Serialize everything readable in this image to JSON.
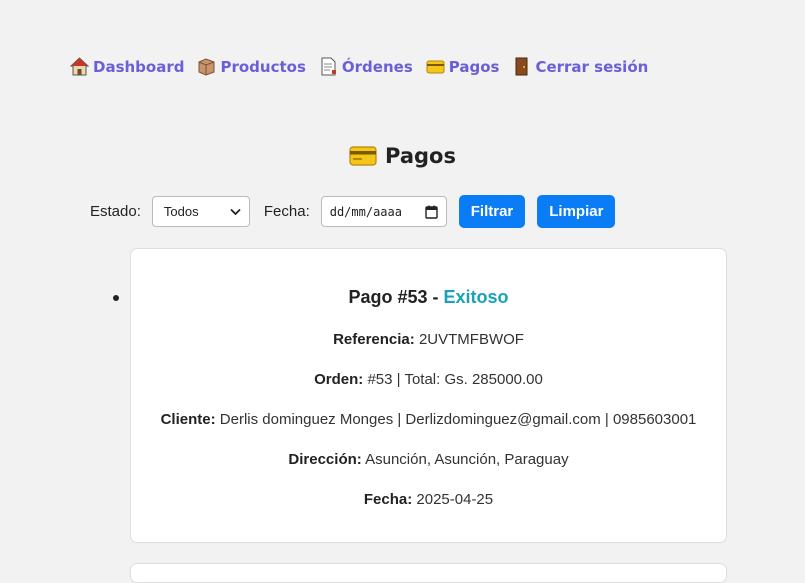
{
  "nav": {
    "items": [
      {
        "label": "Dashboard",
        "icon": "house-icon"
      },
      {
        "label": "Productos",
        "icon": "box-icon"
      },
      {
        "label": "Órdenes",
        "icon": "document-icon"
      },
      {
        "label": "Pagos",
        "icon": "credit-card-icon"
      },
      {
        "label": "Cerrar sesión",
        "icon": "door-icon"
      }
    ]
  },
  "page": {
    "title": "Pagos",
    "title_icon": "credit-card-icon"
  },
  "filters": {
    "estado_label": "Estado:",
    "estado_value": "Todos",
    "fecha_label": "Fecha:",
    "fecha_placeholder": "dd/mm/aaaa",
    "filter_button": "Filtrar",
    "clear_button": "Limpiar"
  },
  "payments": [
    {
      "title": "Pago #53",
      "separator": " - ",
      "status": "Exitoso",
      "referencia_label": "Referencia:",
      "referencia": "2UVTMFBWOF",
      "orden_label": "Orden:",
      "orden": "#53 | Total: Gs. 285000.00",
      "cliente_label": "Cliente:",
      "cliente": "Derlis dominguez Monges | Derlizdominguez@gmail.com | 0985603001",
      "direccion_label": "Dirección:",
      "direccion": "Asunción, Asunción, Paraguay",
      "fecha_label": "Fecha:",
      "fecha": "2025-04-25"
    }
  ],
  "colors": {
    "link": "#6a5fd6",
    "button": "#0a7cf5",
    "status_success": "#1aa2b8"
  }
}
